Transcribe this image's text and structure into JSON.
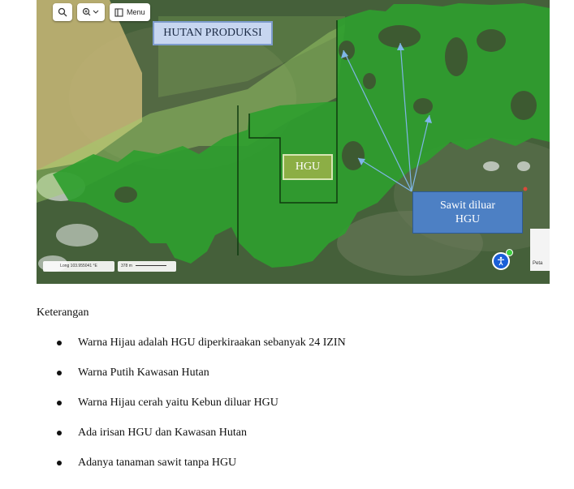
{
  "map": {
    "toolbar": {
      "menu_label": "Menu"
    },
    "labels": {
      "hutan_produksi": "HUTAN PRODUKSI",
      "hgu": "HGU",
      "sawit_line1": "Sawit diluar",
      "sawit_line2": "HGU"
    },
    "scale": {
      "coords": "Long 103.955041 °E",
      "distance": "378 m"
    },
    "side_label": "Peta",
    "colors": {
      "hgu_green": "#2f9e2f",
      "forest_overlay": "#9fd36b",
      "label_blue": "#4d80c4",
      "hgu_label": "#8cae45"
    }
  },
  "legend": {
    "title": "Keterangan",
    "items": [
      "Warna Hijau adalah HGU diperkiraakan sebanyak 24 IZIN",
      "Warna Putih Kawasan Hutan",
      "Warna Hijau cerah yaitu Kebun diluar HGU",
      "Ada irisan HGU dan Kawasan Hutan",
      "Adanya tanaman sawit tanpa HGU"
    ]
  }
}
